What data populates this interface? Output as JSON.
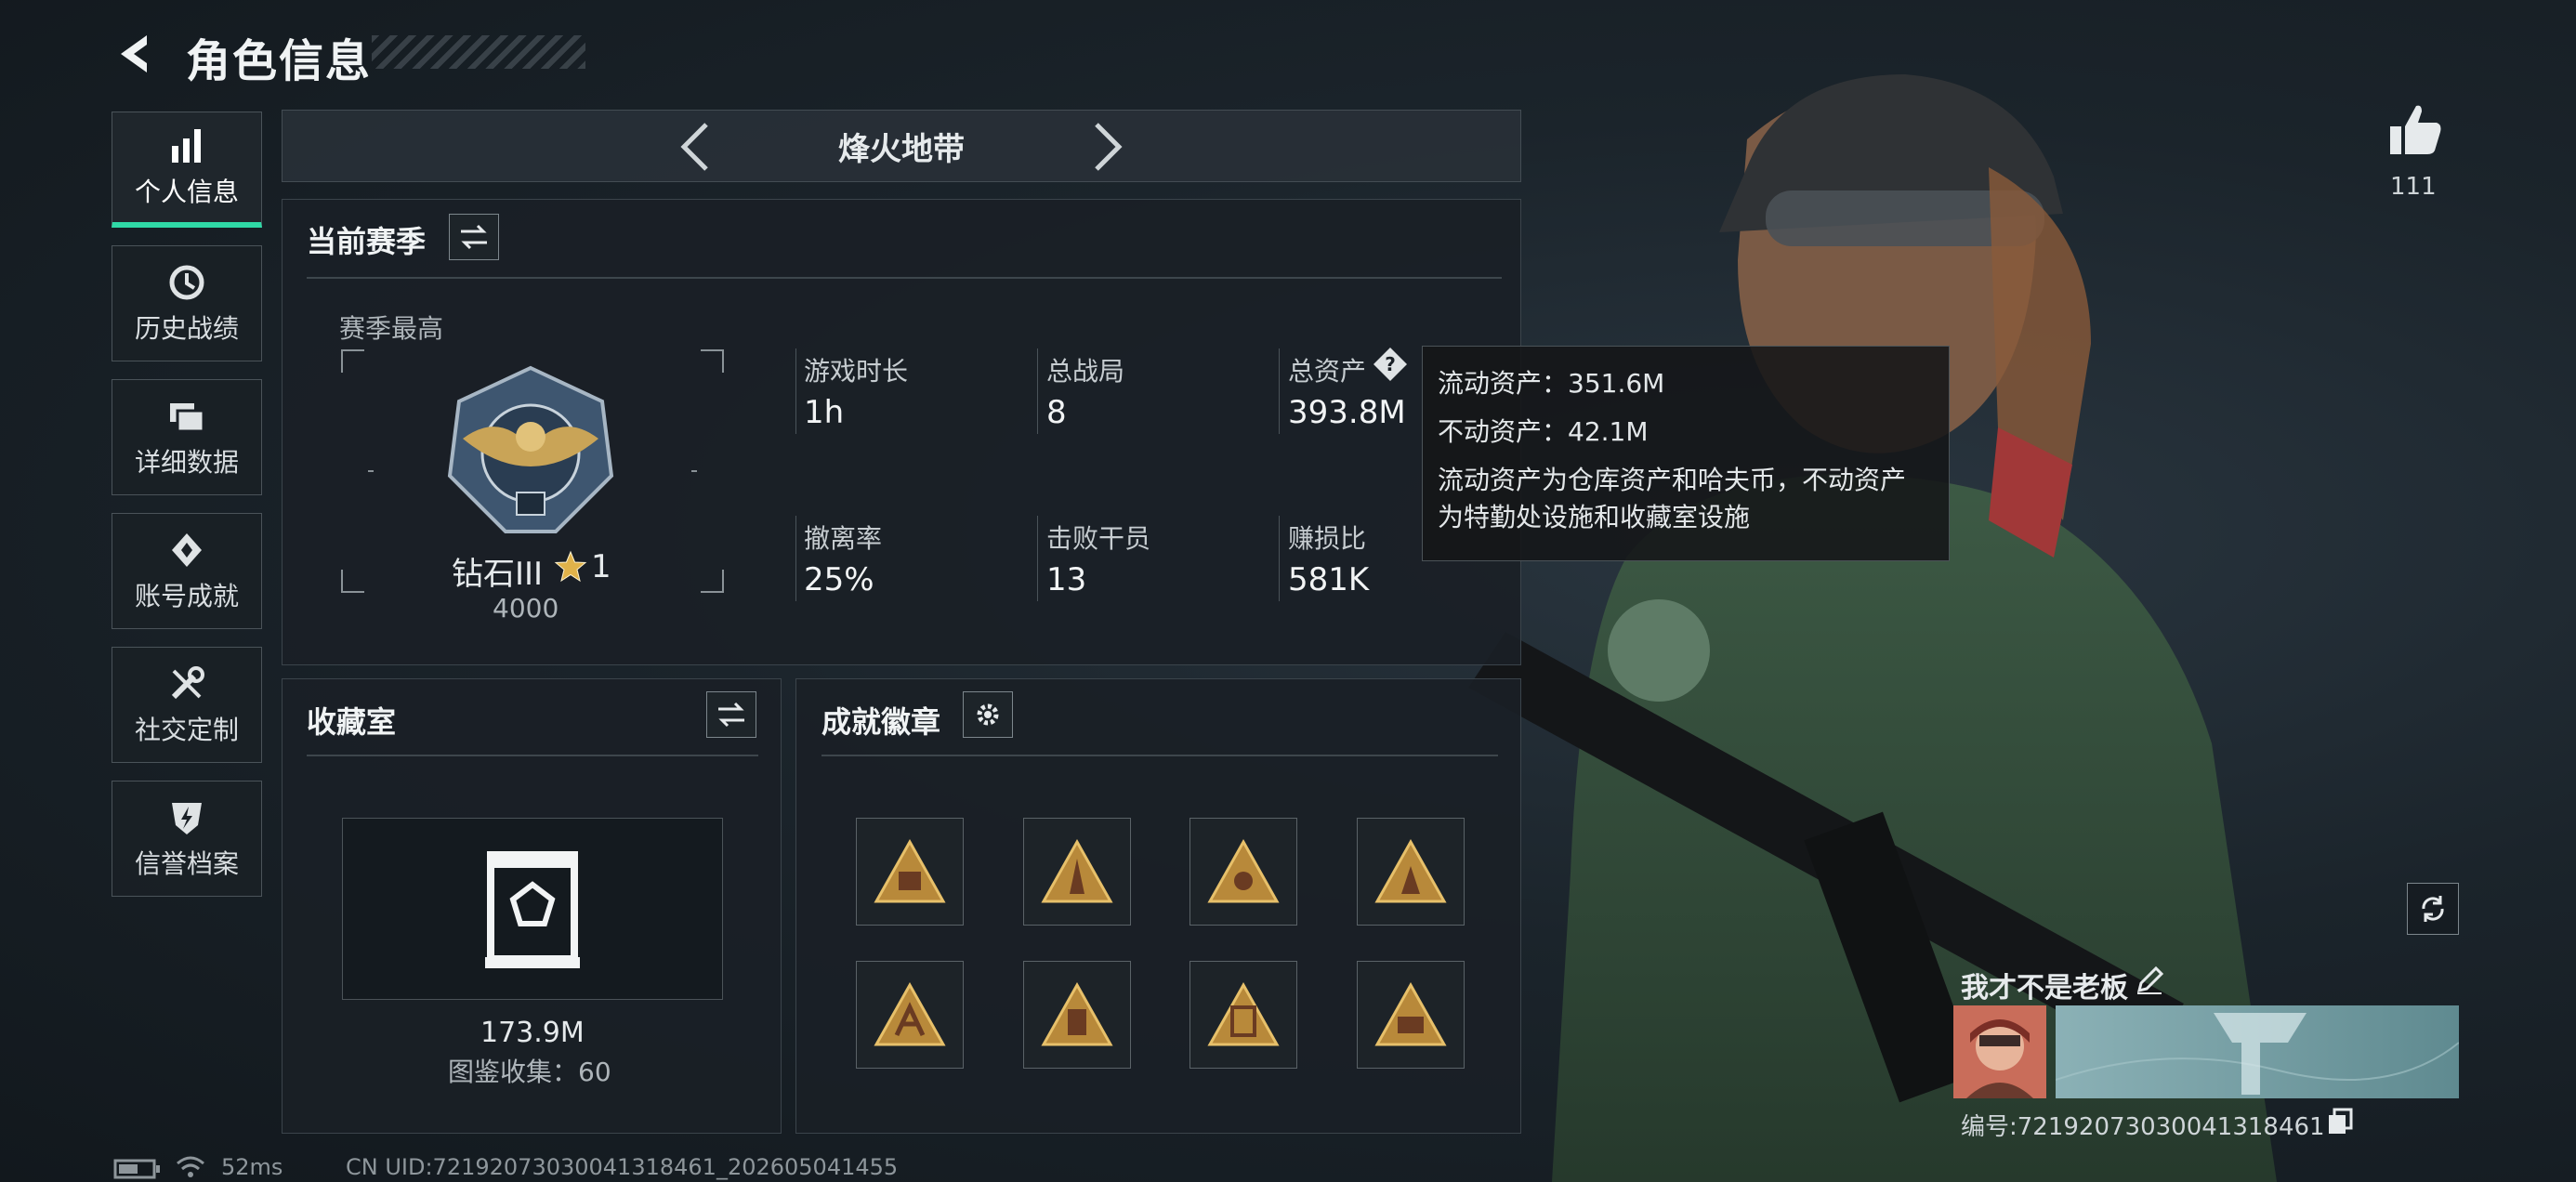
{
  "header": {
    "title": "角色信息"
  },
  "sidebar": {
    "items": [
      {
        "label": "个人信息",
        "icon": "bar-chart-icon",
        "active": true
      },
      {
        "label": "历史战绩",
        "icon": "history-icon"
      },
      {
        "label": "详细数据",
        "icon": "folders-icon"
      },
      {
        "label": "账号成就",
        "icon": "achievement-icon"
      },
      {
        "label": "社交定制",
        "icon": "wrench-icon"
      },
      {
        "label": "信誉档案",
        "icon": "reputation-icon"
      }
    ]
  },
  "mode": {
    "name": "烽火地带"
  },
  "season": {
    "title": "当前赛季",
    "best_label": "赛季最高",
    "rank_name": "钻石III",
    "rank_stars": "1",
    "rank_points": "4000",
    "stats": [
      {
        "label": "游戏时长",
        "value": "1h"
      },
      {
        "label": "总战局",
        "value": "8"
      },
      {
        "label": "总资产",
        "value": "393.8M"
      },
      {
        "label": "撤离率",
        "value": "25%"
      },
      {
        "label": "击败干员",
        "value": "13"
      },
      {
        "label": "赚损比",
        "value": "581K"
      }
    ]
  },
  "tooltip": {
    "liquid": "流动资产：351.6M",
    "fixed": "不动资产：42.1M",
    "desc_line1": "流动资产为仓库资产和哈夫币，不动资产",
    "desc_line2": "为特勤处设施和收藏室设施"
  },
  "collection": {
    "title": "收藏室",
    "value": "173.9M",
    "catalog": "图鉴收集：60"
  },
  "achievements": {
    "title": "成就徽章"
  },
  "likes": {
    "count": "111"
  },
  "player": {
    "name": "我才不是老板",
    "uid_line": "编号:72192073030041318461"
  },
  "status": {
    "ping": "52ms",
    "uid": "CN UID:72192073030041318461_202605041455"
  },
  "colors": {
    "accent": "#2fd9a6",
    "gold": "#d8a640",
    "bg": "#1b242b"
  }
}
